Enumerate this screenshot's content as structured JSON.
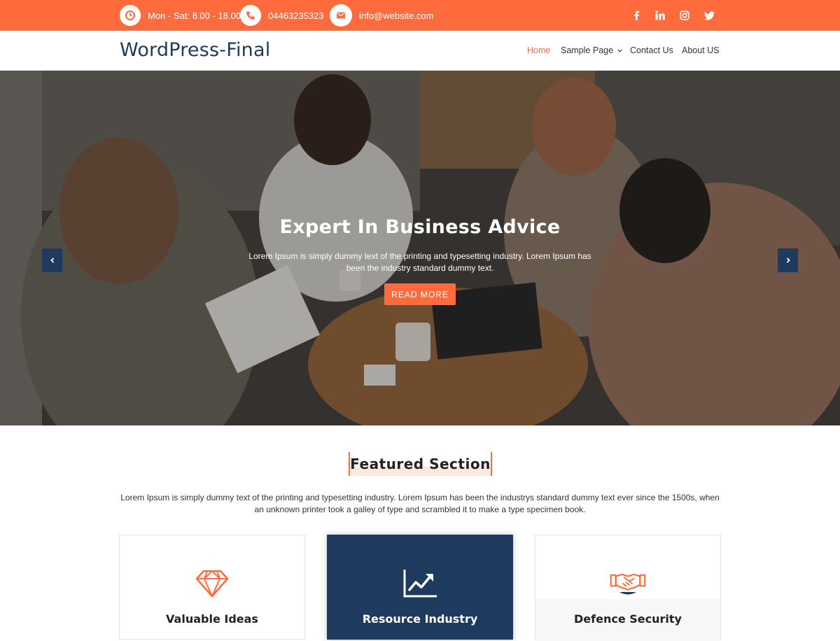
{
  "topbar": {
    "hours": "Mon - Sat: 8.00 - 18.00",
    "phone": "04463235323",
    "email": "info@website.com",
    "icons": [
      "clock-icon",
      "phone-icon",
      "envelope-icon"
    ],
    "social": [
      "facebook-icon",
      "linkedin-icon",
      "instagram-icon",
      "twitter-icon"
    ]
  },
  "header": {
    "logo": "WordPress-Final",
    "nav": {
      "home": "Home",
      "sample_page": "Sample Page",
      "contact": "Contact Us",
      "about": "About US"
    }
  },
  "hero": {
    "title": "Expert In Business Advice",
    "text": "Lorem Ipsum is simply dummy text of the printing and typesetting industry. Lorem Ipsum has been the industry standard dummy text.",
    "button": "READ MORE"
  },
  "featured": {
    "title": "Featured Section",
    "text": "Lorem Ipsum is simply dummy text of the printing and typesetting industry. Lorem Ipsum has been the industrys standard dummy text ever since the 1500s, when an unknown printer took a galley of type and scrambled it to make a type specimen book.",
    "cards": [
      {
        "title": "Valuable Ideas",
        "icon": "diamond-icon"
      },
      {
        "title": "Resource Industry",
        "icon": "chart-line-icon"
      },
      {
        "title": "Defence Security",
        "icon": "handshake-icon"
      }
    ]
  },
  "colors": {
    "accent": "#ff6b3d",
    "navy": "#1f3a5f"
  }
}
